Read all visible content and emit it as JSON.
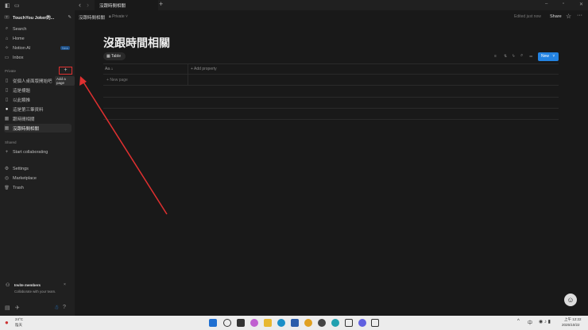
{
  "window": {
    "tab_title": "沒跟時間相關",
    "new_tab": "+",
    "back": "‹",
    "forward": "›",
    "min": "–",
    "max": "▫",
    "close": "✕"
  },
  "sidebar": {
    "workspace": "TouchYou Joker的...",
    "workspace_initial": "T",
    "nav": [
      {
        "label": "Search",
        "icon": "⌕"
      },
      {
        "label": "Home",
        "icon": "⌂"
      },
      {
        "label": "Notion AI",
        "icon": "✧",
        "badge": "New"
      },
      {
        "label": "Inbox",
        "icon": "▭"
      }
    ],
    "private_label": "Private",
    "add_page_tooltip": "Add a page",
    "pages": [
      {
        "label": "從個人桌面版開始吧",
        "icon": "▯"
      },
      {
        "label": "這是標題",
        "icon": "▯"
      },
      {
        "label": "以此類推",
        "icon": "▯"
      },
      {
        "label": "這是第三筆資料",
        "icon": "●"
      },
      {
        "label": "跟時間相關",
        "icon": "▦"
      },
      {
        "label": "沒跟時間相關",
        "icon": "▦",
        "active": true
      }
    ],
    "shared_label": "Shared",
    "start_collab": "Start collaborating",
    "bottom": [
      {
        "label": "Settings",
        "icon": "⚙"
      },
      {
        "label": "Marketplace",
        "icon": "◎"
      },
      {
        "label": "Trash",
        "icon": "🗑"
      }
    ],
    "invite_title": "Invite members",
    "invite_sub": "Collaborate with your team."
  },
  "header": {
    "breadcrumb": "沒跟時間相關",
    "privacy": "Private",
    "edited": "Edited just now",
    "share": "Share"
  },
  "page": {
    "title": "沒跟時間相關",
    "view_tab": "Table",
    "name_col": "Aa",
    "add_property": "Add property",
    "new_page": "New page",
    "new_button": "New"
  },
  "taskbar": {
    "weather_temp": "24°C",
    "weather_text": "陰天",
    "ime": "中",
    "time": "上午 12:22",
    "date": "2025/10/22"
  },
  "colors": {
    "accent": "#2383e2",
    "annotation": "#e03030"
  }
}
